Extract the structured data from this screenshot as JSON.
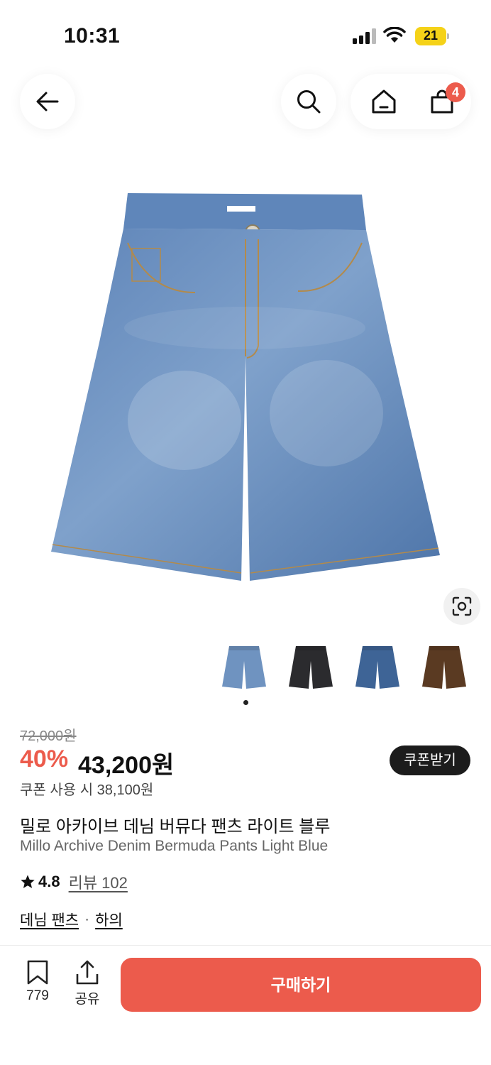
{
  "status_bar": {
    "time": "10:31",
    "battery": "21"
  },
  "nav": {
    "cart_count": "4"
  },
  "pricing": {
    "original_price": "72,000원",
    "discount": "40%",
    "sale_price": "43,200원",
    "coupon_button": "쿠폰받기",
    "coupon_price": "쿠폰 사용 시 38,100원"
  },
  "product": {
    "name_ko": "밀로 아카이브 데님 버뮤다 팬츠 라이트 블루",
    "name_en": "Millo Archive Denim Bermuda Pants Light Blue",
    "rating": "4.8",
    "review_label": "리뷰 102",
    "categories": [
      "데님 팬츠",
      "하의"
    ],
    "category_separator": "·",
    "thumbnails": [
      {
        "color_name": "light-blue",
        "color": "#6f93c0"
      },
      {
        "color_name": "black",
        "color": "#2b2b2e"
      },
      {
        "color_name": "mid-blue",
        "color": "#3e6496"
      },
      {
        "color_name": "brown",
        "color": "#5a3a22"
      }
    ]
  },
  "bottom_bar": {
    "bookmark_count": "779",
    "share_label": "공유",
    "buy_button": "구매하기"
  },
  "colors": {
    "accent": "#ec5b4c",
    "dark": "#1c1c1c"
  }
}
